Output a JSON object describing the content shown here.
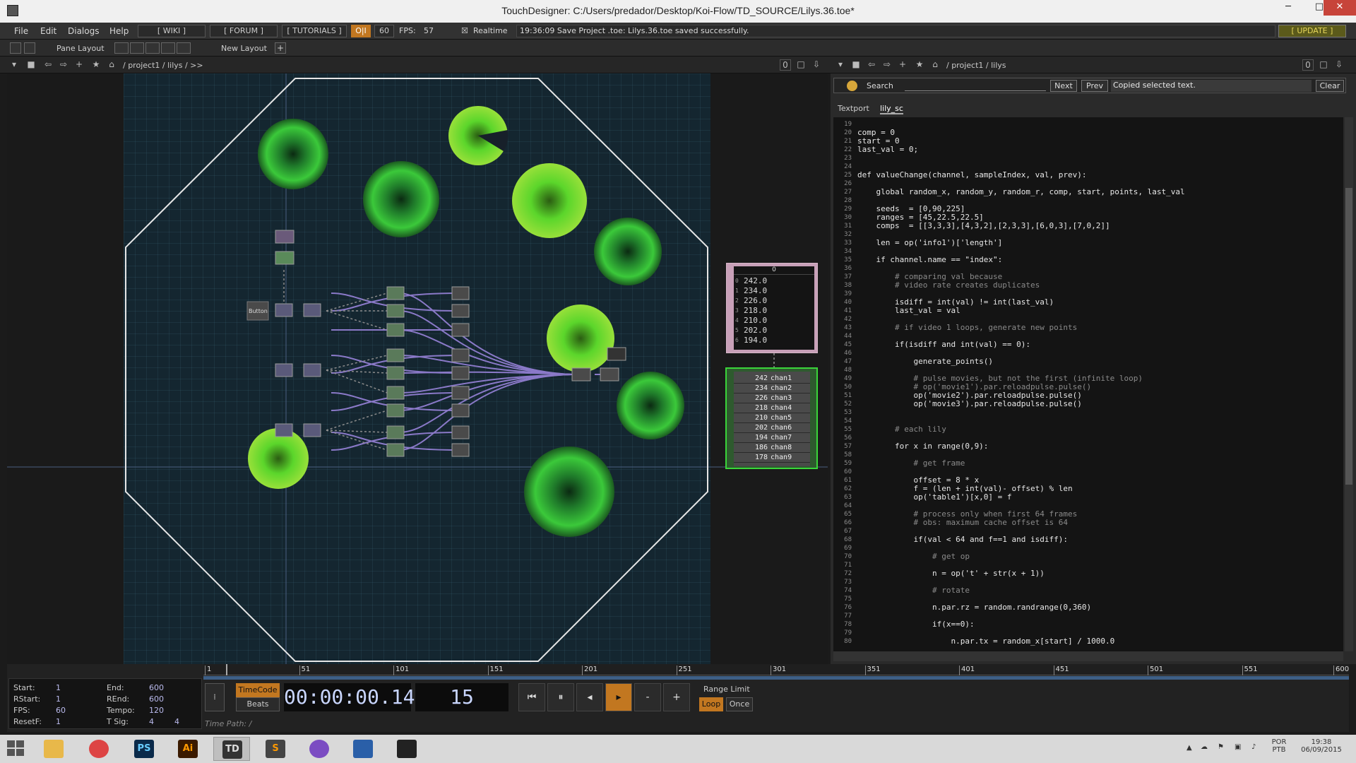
{
  "window": {
    "title": "TouchDesigner: C:/Users/predador/Desktop/Koi-Flow/TD_SOURCE/Lilys.36.toe*",
    "minimize": "─",
    "maximize": "□",
    "close": "✕"
  },
  "menubar": {
    "file": "File",
    "edit": "Edit",
    "dialogs": "Dialogs",
    "help": "Help",
    "wiki": "[ WIKI ]",
    "forum": "[ FORUM ]",
    "tutorials": "[ TUTORIALS ]",
    "oi": "O|I",
    "fps_cap": "60",
    "fps_label": "FPS:",
    "fps_value": "57",
    "realtime": "Realtime",
    "status_message": "19:36:09 Save Project .toe: Lilys.36.toe saved successfully.",
    "update": "[ UPDATE ]"
  },
  "panebar": {
    "pane_layout": "Pane Layout",
    "new_layout": "New Layout"
  },
  "network_path": {
    "path": "/ project1 / lilys / >>",
    "zoom": "0"
  },
  "textport_path": {
    "path": "/ project1 / lilys",
    "zoom": "0"
  },
  "search": {
    "label": "Search",
    "next": "Next",
    "prev": "Prev",
    "message": "Copied selected text.",
    "clear": "Clear"
  },
  "tabs": {
    "textport": "Textport",
    "lily_sc": "lily_sc"
  },
  "network": {
    "button_label": "Button",
    "table_header": "0",
    "table_rows": [
      {
        "i": "0",
        "v": "242.0"
      },
      {
        "i": "1",
        "v": "234.0"
      },
      {
        "i": "2",
        "v": "226.0"
      },
      {
        "i": "3",
        "v": "218.0"
      },
      {
        "i": "4",
        "v": "210.0"
      },
      {
        "i": "5",
        "v": "202.0"
      },
      {
        "i": "6",
        "v": "194.0"
      }
    ],
    "chop_rows": [
      {
        "v": "242",
        "n": "chan1"
      },
      {
        "v": "234",
        "n": "chan2"
      },
      {
        "v": "226",
        "n": "chan3"
      },
      {
        "v": "218",
        "n": "chan4"
      },
      {
        "v": "210",
        "n": "chan5"
      },
      {
        "v": "202",
        "n": "chan6"
      },
      {
        "v": "194",
        "n": "chan7"
      },
      {
        "v": "186",
        "n": "chan8"
      },
      {
        "v": "178",
        "n": "chan9"
      }
    ]
  },
  "code": [
    {
      "n": "19",
      "t": ""
    },
    {
      "n": "20",
      "t": "comp = 0"
    },
    {
      "n": "21",
      "t": "start = 0"
    },
    {
      "n": "22",
      "t": "last_val = 0;"
    },
    {
      "n": "23",
      "t": ""
    },
    {
      "n": "24",
      "t": ""
    },
    {
      "n": "25",
      "t": "def valueChange(channel, sampleIndex, val, prev):"
    },
    {
      "n": "26",
      "t": ""
    },
    {
      "n": "27",
      "t": "    global random_x, random_y, random_r, comp, start, points, last_val"
    },
    {
      "n": "28",
      "t": ""
    },
    {
      "n": "29",
      "t": "    seeds  = [0,90,225]"
    },
    {
      "n": "30",
      "t": "    ranges = [45,22.5,22.5]"
    },
    {
      "n": "31",
      "t": "    comps  = [[3,3,3],[4,3,2],[2,3,3],[6,0,3],[7,0,2]]"
    },
    {
      "n": "32",
      "t": ""
    },
    {
      "n": "33",
      "t": "    len = op('info1')['length']"
    },
    {
      "n": "34",
      "t": ""
    },
    {
      "n": "35",
      "t": "    if channel.name == \"index\":"
    },
    {
      "n": "36",
      "t": ""
    },
    {
      "n": "37",
      "t": "        # comparing val because"
    },
    {
      "n": "38",
      "t": "        # video rate creates duplicates"
    },
    {
      "n": "39",
      "t": ""
    },
    {
      "n": "40",
      "t": "        isdiff = int(val) != int(last_val)"
    },
    {
      "n": "41",
      "t": "        last_val = val"
    },
    {
      "n": "42",
      "t": ""
    },
    {
      "n": "43",
      "t": "        # if video 1 loops, generate new points"
    },
    {
      "n": "44",
      "t": ""
    },
    {
      "n": "45",
      "t": "        if(isdiff and int(val) == 0):"
    },
    {
      "n": "46",
      "t": ""
    },
    {
      "n": "47",
      "t": "            generate_points()"
    },
    {
      "n": "48",
      "t": ""
    },
    {
      "n": "49",
      "t": "            # pulse movies, but not the first (infinite loop)"
    },
    {
      "n": "50",
      "t": "            # op('movie1').par.reloadpulse.pulse()"
    },
    {
      "n": "51",
      "t": "            op('movie2').par.reloadpulse.pulse()"
    },
    {
      "n": "52",
      "t": "            op('movie3').par.reloadpulse.pulse()"
    },
    {
      "n": "53",
      "t": ""
    },
    {
      "n": "54",
      "t": ""
    },
    {
      "n": "55",
      "t": "        # each lily"
    },
    {
      "n": "56",
      "t": ""
    },
    {
      "n": "57",
      "t": "        for x in range(0,9):"
    },
    {
      "n": "58",
      "t": ""
    },
    {
      "n": "59",
      "t": "            # get frame"
    },
    {
      "n": "60",
      "t": ""
    },
    {
      "n": "61",
      "t": "            offset = 8 * x"
    },
    {
      "n": "62",
      "t": "            f = (len + int(val)- offset) % len"
    },
    {
      "n": "63",
      "t": "            op('table1')[x,0] = f"
    },
    {
      "n": "64",
      "t": ""
    },
    {
      "n": "65",
      "t": "            # process only when first 64 frames"
    },
    {
      "n": "66",
      "t": "            # obs: maximum cache offset is 64"
    },
    {
      "n": "67",
      "t": ""
    },
    {
      "n": "68",
      "t": "            if(val < 64 and f==1 and isdiff):"
    },
    {
      "n": "69",
      "t": ""
    },
    {
      "n": "70",
      "t": "                # get op"
    },
    {
      "n": "71",
      "t": ""
    },
    {
      "n": "72",
      "t": "                n = op('t' + str(x + 1))"
    },
    {
      "n": "73",
      "t": ""
    },
    {
      "n": "74",
      "t": "                # rotate"
    },
    {
      "n": "75",
      "t": ""
    },
    {
      "n": "76",
      "t": "                n.par.rz = random.randrange(0,360)"
    },
    {
      "n": "77",
      "t": ""
    },
    {
      "n": "78",
      "t": "                if(x==0):"
    },
    {
      "n": "79",
      "t": ""
    },
    {
      "n": "80",
      "t": "                    n.par.tx = random_x[start] / 1000.0"
    }
  ],
  "timeline": {
    "ticks": [
      "1",
      "51",
      "101",
      "151",
      "201",
      "251",
      "301",
      "351",
      "401",
      "451",
      "501",
      "551",
      "600"
    ],
    "start_label": "Start:",
    "start": "1",
    "end_label": "End:",
    "end": "600",
    "rstart_label": "RStart:",
    "rstart": "1",
    "rend_label": "REnd:",
    "rend": "600",
    "fps_label": "FPS:",
    "fps": "60",
    "tempo_label": "Tempo:",
    "tempo": "120",
    "resetf_label": "ResetF:",
    "resetf": "1",
    "tsig_label": "T Sig:",
    "tsig_a": "4",
    "tsig_b": "4",
    "timecode_btn": "TimeCode",
    "beats_btn": "Beats",
    "timecode": "00:00:00.14",
    "frame": "15",
    "range_limit": "Range Limit",
    "loop": "Loop",
    "once": "Once",
    "time_path": "Time Path: /"
  },
  "taskbar": {
    "apps": [
      "PS",
      "Ai",
      "TD",
      "S"
    ],
    "lang": "POR",
    "lang2": "PTB",
    "time": "19:38",
    "date": "06/09/2015"
  }
}
